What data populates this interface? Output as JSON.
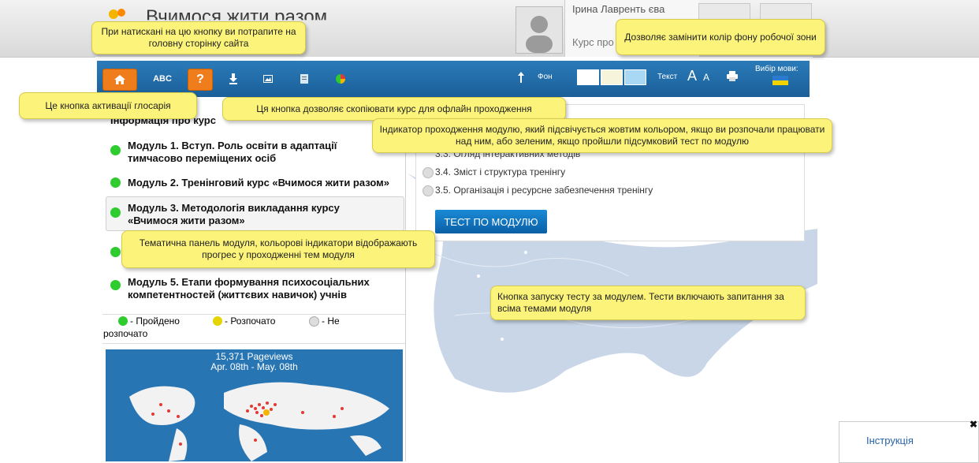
{
  "header": {
    "site_title": "Вчимося жити разом",
    "user_name": "Ірина Лавренть єва",
    "course_progress": "Курс про"
  },
  "toolbar": {
    "abc_label": "ABC",
    "help_label": "?",
    "fon_label": "Фон",
    "text_label": "Текст",
    "font_big": "A",
    "font_small": "A",
    "lang_label": "Вибір мови:",
    "swatch_colors": [
      "#ffffff",
      "#f7f4dc",
      "#a9d8f5"
    ]
  },
  "modules": {
    "info_label": "Інформація про курс",
    "items": [
      {
        "line1": "Модуль 1. Вступ. Роль освіти в адаптації",
        "line2": "тимчасово переміщених осіб",
        "status": "green"
      },
      {
        "line1": "Модуль 2. Тренінговий курс «Вчимося жити разом»",
        "line2": "",
        "status": "green"
      },
      {
        "line1": "Модуль 3. Методологія викладання курсу",
        "line2": "«Вчимося жити разом»",
        "status": "green"
      },
      {
        "line1": "Модуль 5. Етапи формування психосоціальних",
        "line2": "компетентностей (життєвих навичок) учнів",
        "status": "green"
      }
    ]
  },
  "legend": {
    "done": "- Пройдено",
    "started": "- Розпочато",
    "not_started_1": "- Не",
    "not_started_2": "розпочато",
    "colors": {
      "done": "#2ecc2e",
      "started": "#e6d400",
      "not_started": "#dddddd"
    }
  },
  "stats": {
    "pageviews": "15,371 Pageviews",
    "range": "Apr. 08th - May. 08th"
  },
  "topics": {
    "partial_top": "и",
    "partial_methods": "3.3. Огляд інтерактивних методів",
    "items": [
      "3.4. Зміст і структура тренінгу",
      "3.5. Організація і ресурсне забезпечення тренінгу"
    ],
    "test_button": "ТЕСТ ПО МОДУЛЮ"
  },
  "tooltips": {
    "home": "При натискані на цю кнопку ви потрапите на головну сторінку сайта",
    "glossary": "Це кнопка активації глосарія",
    "offline": "Ця кнопка дозволяє скопіювати курс для офлайн проходження",
    "background": "Дозволяє замінити колір фону робочої зони",
    "indicator": "Індикатор проходження модулю, який підсвічується жовтим кольором, якщо ви розпочали працювати над ним, або зеленим, якщо пройшли підсумковий тест по модулю",
    "panel": "Тематична панель модуля, кольорові індикатори відображають прогрес у проходженні тем модуля",
    "test": "Кнопка запуску тесту за модулем. Тести включають запитання за всіма темами модуля"
  },
  "instruction": {
    "link": "Інструкція",
    "close": "✖"
  }
}
